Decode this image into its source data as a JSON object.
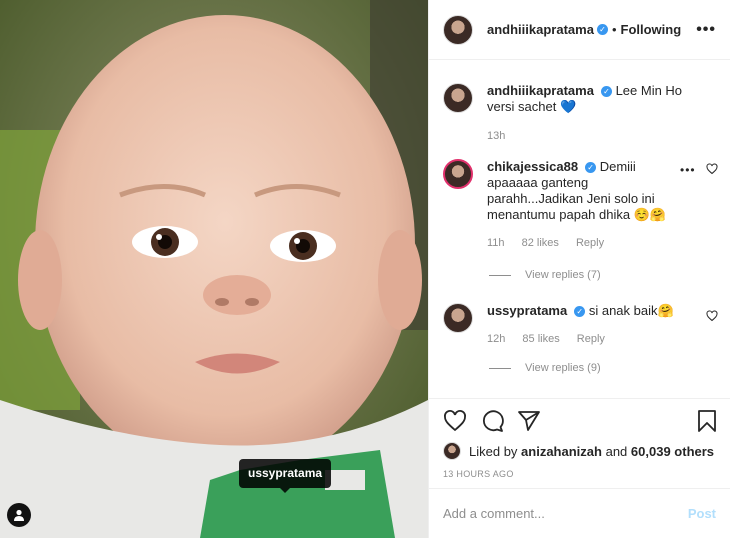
{
  "photo": {
    "tag_label": "ussypratama",
    "user_tag_icon": "person-icon"
  },
  "header": {
    "username": "andhiiikapratama",
    "separator": "•",
    "follow_status": "Following",
    "more": "•••"
  },
  "caption": {
    "username": "andhiiikapratama",
    "text": "Lee Min Ho versi sachet 💙",
    "time": "13h"
  },
  "comments": [
    {
      "username": "chikajessica88",
      "text": "Demiii apaaaaa ganteng parahh...Jadikan Jeni solo ini menantumu papah dhika ☺️🤗",
      "time": "11h",
      "likes": "82 likes",
      "reply": "Reply",
      "view_replies": "View replies (7)",
      "more": "•••"
    },
    {
      "username": "ussypratama",
      "text": "si anak baik🤗",
      "time": "12h",
      "likes": "85 likes",
      "reply": "Reply",
      "view_replies": "View replies (9)"
    }
  ],
  "likes": {
    "prefix": "Liked by ",
    "user": "anizahanizah",
    "middle": " and ",
    "others": "60,039 others"
  },
  "timestamp": "13 HOURS AGO",
  "add_comment": {
    "placeholder": "Add a comment...",
    "post_label": "Post"
  },
  "colors": {
    "verified": "#3897f0",
    "muted": "#8e8e8e",
    "post_disabled": "#b2dffc"
  }
}
